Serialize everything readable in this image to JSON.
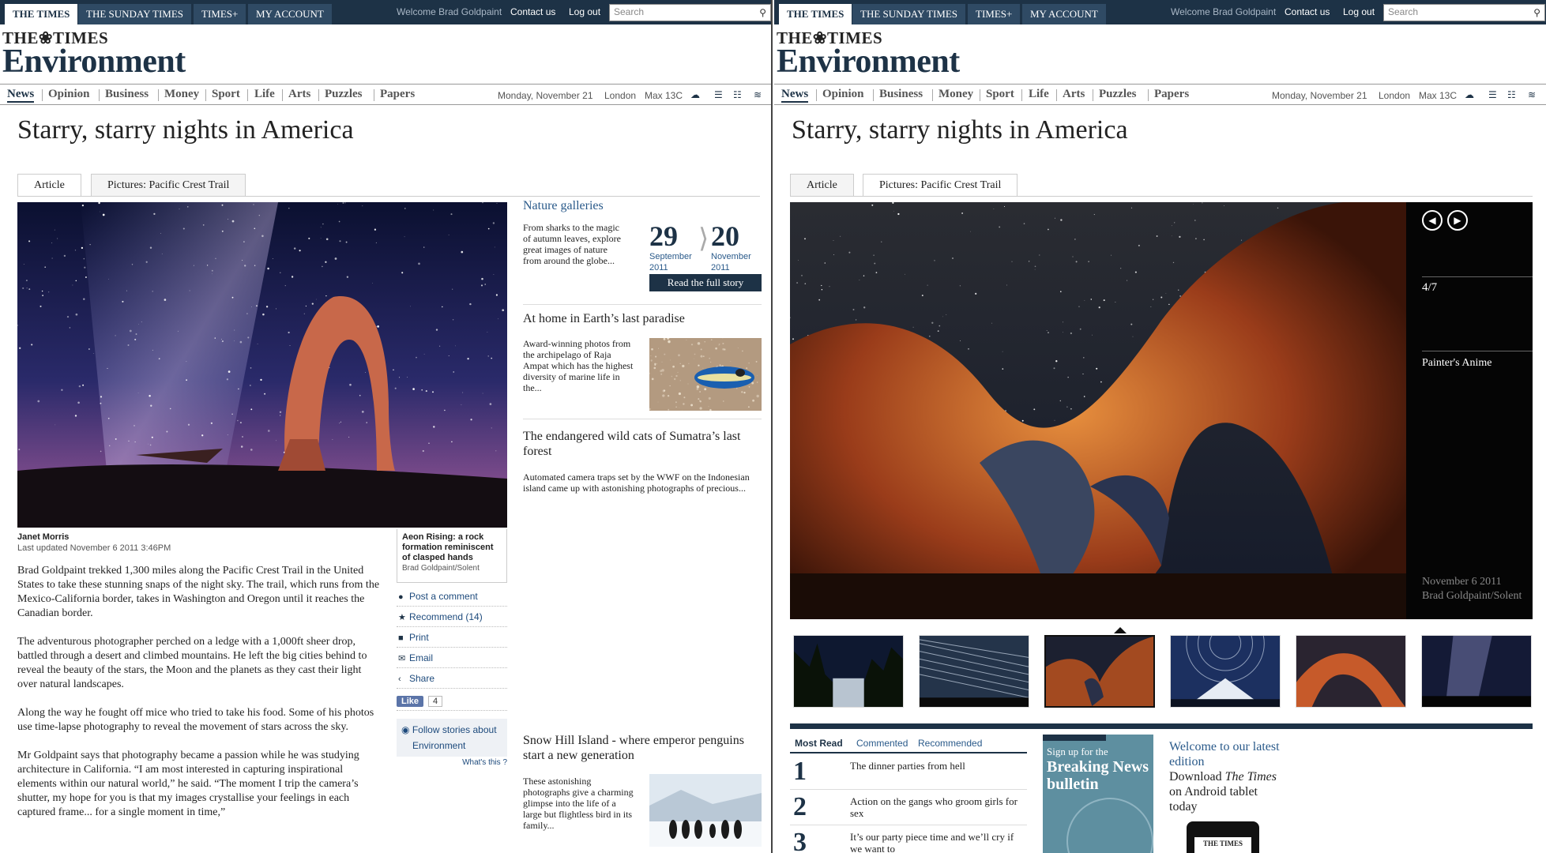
{
  "colors": {
    "navy": "#1d3246",
    "link": "#2a5a8a",
    "bulletin": "#5e8fa0"
  },
  "topbar": {
    "tabs": [
      "THE TIMES",
      "THE SUNDAY TIMES",
      "TIMES+",
      "MY ACCOUNT"
    ],
    "welcome": "Welcome Brad Goldpaint",
    "contact": "Contact us",
    "logout": "Log out",
    "search_placeholder": "Search",
    "search_icon": "magnifier-icon"
  },
  "masthead": {
    "small": "THE❀TIMES",
    "big": "Environment"
  },
  "nav": {
    "items": [
      "News",
      "Opinion",
      "Business",
      "Money",
      "Sport",
      "Life",
      "Arts",
      "Puzzles",
      "Papers"
    ],
    "date": "Monday, November 21",
    "city": "London",
    "weather": "Max 13C",
    "icons": [
      "weather-cloud-icon",
      "list-icon",
      "sitemap-icon",
      "rss-icon"
    ]
  },
  "article": {
    "title": "Starry, starry nights in America",
    "tabs": [
      "Article",
      "Pictures: Pacific Crest Trail"
    ],
    "author": "Janet Morris",
    "updated": "Last updated November 6 2011 3:46PM",
    "caption": "Aeon Rising: a rock formation reminiscent of clasped hands",
    "caption_credit": "Brad Goldpaint/Solent",
    "paragraphs": [
      "Brad Goldpaint trekked 1,300 miles along the Pacific Crest Trail in the United States to take these stunning snaps of the night sky. The trail, which runs from the Mexico-California border, takes in Washington and Oregon until it reaches the Canadian border.",
      "The adventurous photographer perched on a ledge with a 1,000ft sheer drop, battled through a desert and climbed mountains. He left the big cities behind to reveal the beauty of the stars, the Moon and the planets as they cast their light over natural landscapes.",
      "Along the way he fought off mice who tried to take his food. Some of his photos use time-lapse photography to reveal the movement of stars across the sky.",
      "Mr Goldpaint says that photography became a passion while he was studying architecture in California. “I am most interested in capturing inspirational elements within our natural world,” he said. “The moment I trip the camera’s shutter, my hope for you is that my images crystallise your feelings in each captured frame... for a single moment in time,”"
    ],
    "share": [
      {
        "icon": "comment-icon",
        "glyph": "●",
        "label": "Post a comment"
      },
      {
        "icon": "star-icon",
        "glyph": "★",
        "label": "Recommend (14)"
      },
      {
        "icon": "print-icon",
        "glyph": "■",
        "label": "Print"
      },
      {
        "icon": "email-icon",
        "glyph": "✉",
        "label": "Email"
      },
      {
        "icon": "share-icon",
        "glyph": "‹",
        "label": "Share"
      }
    ],
    "fb_like": "Like",
    "fb_count": "4",
    "follow_label": "Follow stories about",
    "follow_topic": "Environment",
    "whats_this": "What's this"
  },
  "sidebar": {
    "galleries_title": "Nature galleries",
    "galleries_text": "From sharks to the magic of autumn leaves, explore great images of nature from around the globe...",
    "date_from_day": "29",
    "date_from_month": "September",
    "date_from_year": "2011",
    "date_to_day": "20",
    "date_to_month": "November",
    "date_to_year": "2011",
    "read_full": "Read the full story",
    "story2_title": "At home in Earth’s last paradise",
    "story2_text": "Award-winning photos from the archipelago of Raja Ampat which has the highest diversity of marine life in the...",
    "story3_title": "The endangered wild cats of Sumatra’s last forest",
    "story3_text": "Automated camera traps set by the WWF on the Indonesian island came up with astonishing photographs of precious...",
    "story4_title": "Snow Hill Island - where emperor penguins start a new generation",
    "story4_text": "These astonishing photographs give a charming glimpse into the life of a large but flightless bird in its family..."
  },
  "gallery": {
    "prev_icon": "arrow-left-icon",
    "next_icon": "arrow-right-icon",
    "counter": "4/7",
    "photo_title": "Painter's Anime",
    "photo_date": "November 6 2011",
    "photo_credit": "Brad Goldpaint/Solent",
    "thumb_count": 6,
    "active_index": 2
  },
  "most_read": {
    "tabs": [
      "Most Read",
      "Commented",
      "Recommended"
    ],
    "items": [
      {
        "rank": "1",
        "title": "The dinner parties from hell"
      },
      {
        "rank": "2",
        "title": "Action on the gangs who groom girls for sex"
      },
      {
        "rank": "3",
        "title": "It’s our party piece time and we’ll cry if we want to"
      }
    ]
  },
  "bulletin": {
    "small": "Sign up for the",
    "big": "Breaking News bulletin"
  },
  "promo": {
    "welcome": "Welcome to our latest edition",
    "download": "Download",
    "paper": "The Times",
    "android": "on Android tablet today",
    "tablet_logo": "THE TIMES"
  }
}
